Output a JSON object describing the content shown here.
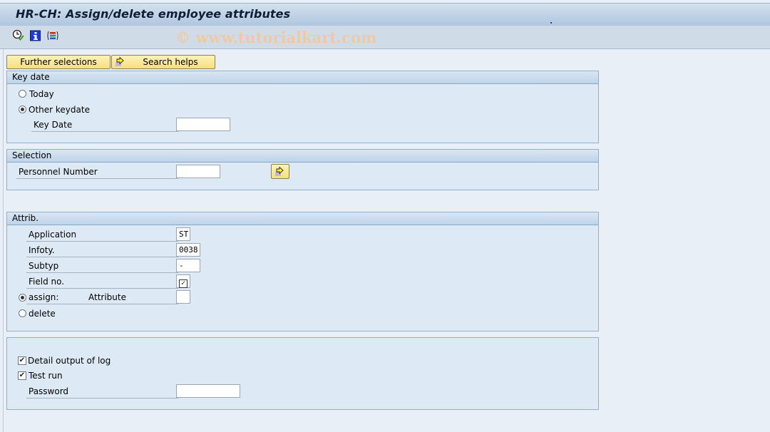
{
  "window": {
    "title": "HR-CH: Assign/delete employee attributes",
    "watermark": "© www.tutorialkart.com"
  },
  "toolbar": {
    "icons": [
      "execute-icon",
      "info-icon",
      "selection-options-icon"
    ]
  },
  "buttons": {
    "further_selections": "Further selections",
    "search_helps": "Search helps"
  },
  "key_date_group": {
    "header": "Key date",
    "options": [
      {
        "label": "Today",
        "selected": false
      },
      {
        "label": "Other keydate",
        "selected": true
      }
    ],
    "key_date_label": "Key Date",
    "key_date_value": ""
  },
  "selection_group": {
    "header": "Selection",
    "personnel_number_label": "Personnel Number",
    "personnel_number_value": ""
  },
  "attrib_group": {
    "header": "Attrib.",
    "application_label": "Application",
    "application_value": "ST",
    "infotype_label": "Infoty.",
    "infotype_value": "0038",
    "subtype_label": "Subtyp",
    "subtype_value": "-",
    "field_no_label": "Field no.",
    "field_no_checked": true,
    "assign_label": "assign:",
    "assign_selected": true,
    "attribute_label": "Attribute",
    "attribute_value": "",
    "delete_label": "delete",
    "delete_selected": false
  },
  "options_group": {
    "detail_log_label": "Detail output of log",
    "detail_log_checked": true,
    "test_run_label": "Test run",
    "test_run_checked": true,
    "password_label": "Password",
    "password_value": ""
  },
  "glyphs": {
    "check": "✓",
    "check_small": "✔"
  }
}
